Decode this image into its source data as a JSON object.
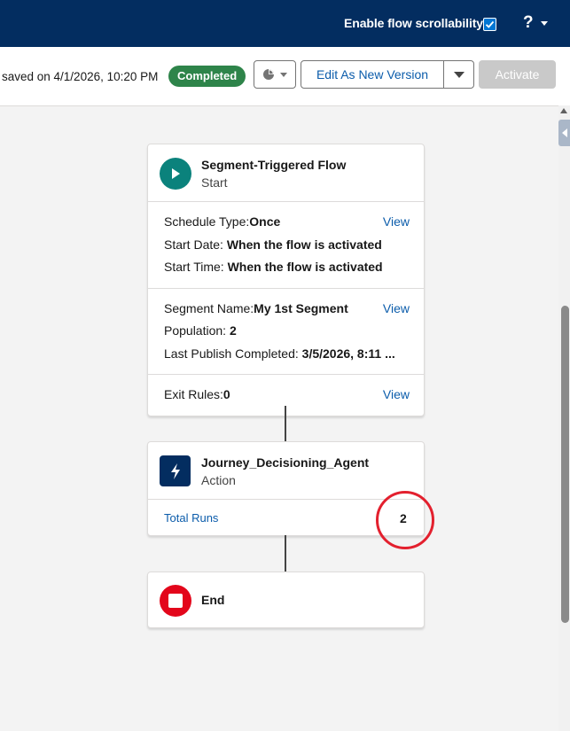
{
  "topbar": {
    "scroll_label": "Enable flow scrollability",
    "help_label": "?"
  },
  "toolbar": {
    "saved_text": "saved on 4/1/2026, 10:20 PM",
    "status_badge": "Completed",
    "edit_label": "Edit As New Version",
    "activate_label": "Activate"
  },
  "start_node": {
    "title": "Segment-Triggered Flow",
    "subtitle": "Start",
    "schedule": {
      "schedule_type_label": "Schedule Type:",
      "schedule_type_value": "Once",
      "start_date_label": "Start Date:",
      "start_date_value": "When the flow is activated",
      "start_time_label": "Start Time:",
      "start_time_value": "When the flow is activated",
      "view_label": "View"
    },
    "segment": {
      "segment_name_label": "Segment Name:",
      "segment_name_value": "My 1st Segment",
      "population_label": "Population:",
      "population_value": "2",
      "last_publish_label": "Last Publish Completed:",
      "last_publish_value": "3/5/2026, 8:11 ...",
      "view_label": "View"
    },
    "exit": {
      "exit_rules_label": "Exit Rules:",
      "exit_rules_value": "0",
      "view_label": "View"
    }
  },
  "action_node": {
    "title": "Journey_Decisioning_Agent",
    "subtitle": "Action",
    "total_runs_label": "Total Runs",
    "total_runs_value": "2"
  },
  "end_node": {
    "title": "End"
  },
  "colors": {
    "topbar": "#032d60",
    "badge": "#2e844a",
    "start_icon": "#0b827c",
    "action_icon": "#032d60",
    "end_icon": "#e3061b",
    "link": "#0b5cab",
    "highlight": "#e3202e"
  },
  "icons": {
    "checkbox": "checkmark-icon",
    "help_caret": "chevron-down-icon",
    "chart": "pie-chart-icon",
    "start": "play-icon",
    "action": "lightning-bolt-icon",
    "end": "stop-icon"
  }
}
